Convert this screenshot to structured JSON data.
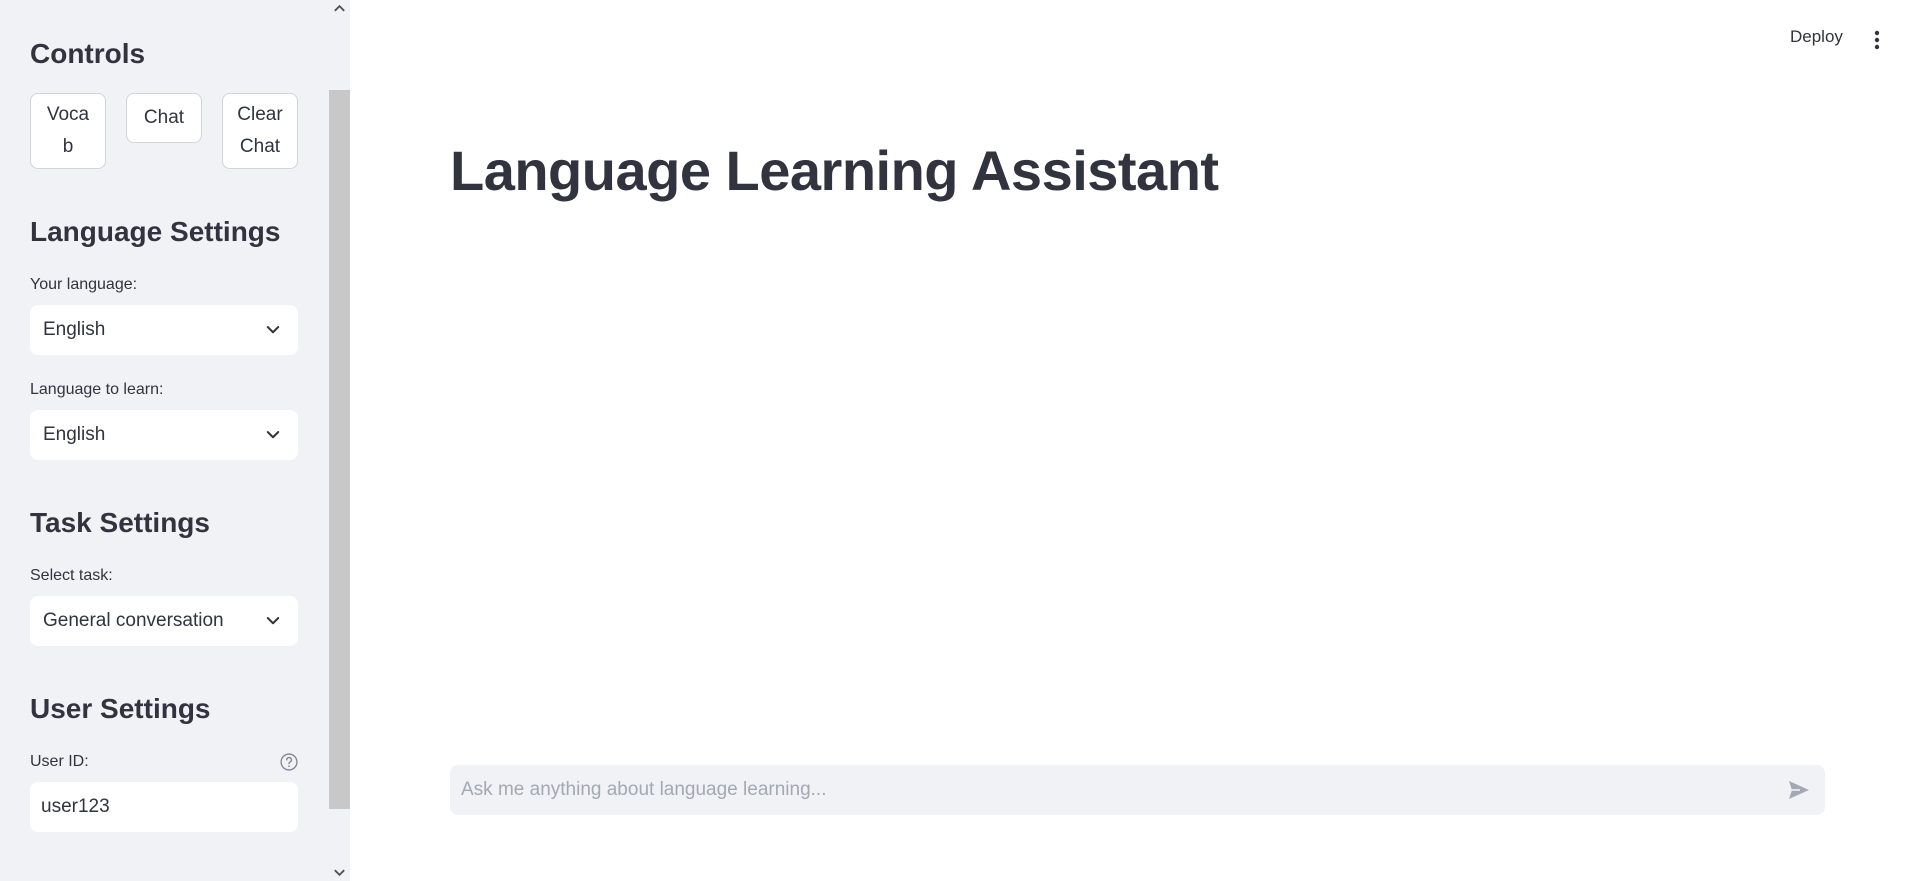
{
  "sidebar": {
    "controls_heading": "Controls",
    "buttons": {
      "vocab_line1": "Voca",
      "vocab_line2": "b",
      "chat": "Chat",
      "clear_line1": "Clear",
      "clear_line2": "Chat"
    },
    "language_heading": "Language Settings",
    "your_language_label": "Your language:",
    "your_language_value": "English",
    "learn_language_label": "Language to learn:",
    "learn_language_value": "English",
    "task_heading": "Task Settings",
    "task_label": "Select task:",
    "task_value": "General conversation",
    "user_heading": "User Settings",
    "user_id_label": "User ID:",
    "user_id_value": "user123"
  },
  "header": {
    "deploy_label": "Deploy",
    "menu_icon": "more-vertical-icon"
  },
  "main": {
    "title": "Language Learning Assistant",
    "chat_placeholder": "Ask me anything about language learning...",
    "send_icon": "send-icon"
  },
  "colors": {
    "sidebar_bg": "#f0f2f6",
    "text": "#31333f",
    "placeholder": "#a3a8b4"
  }
}
